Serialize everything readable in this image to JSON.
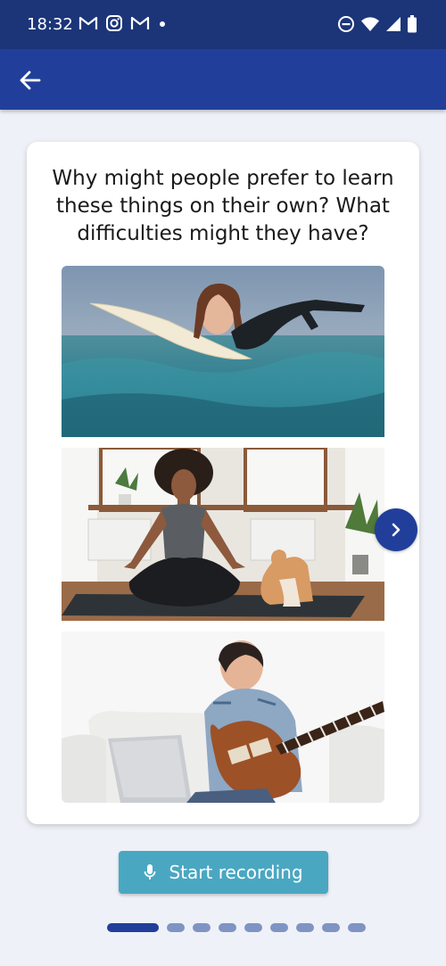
{
  "status_bar": {
    "time": "18:32",
    "left_icons": [
      "gmail-icon",
      "instagram-icon",
      "gmail-icon",
      "notification-dot-icon"
    ],
    "right_icons": [
      "do-not-disturb-icon",
      "wifi-icon",
      "signal-icon",
      "battery-icon"
    ]
  },
  "app_bar": {
    "back_icon": "arrow-left-icon",
    "color": "#213f9a"
  },
  "card": {
    "question": "Why might people prefer to learn these things on their own? What difficulties might they have?",
    "images": [
      "photo-surfing",
      "photo-yoga-with-dog",
      "photo-guitar-with-laptop"
    ]
  },
  "next_button": {
    "icon": "chevron-right-icon"
  },
  "record_button": {
    "label": "Start recording",
    "icon": "microphone-icon",
    "color": "#4aa7c2"
  },
  "pagination": {
    "total": 9,
    "current": 1
  }
}
